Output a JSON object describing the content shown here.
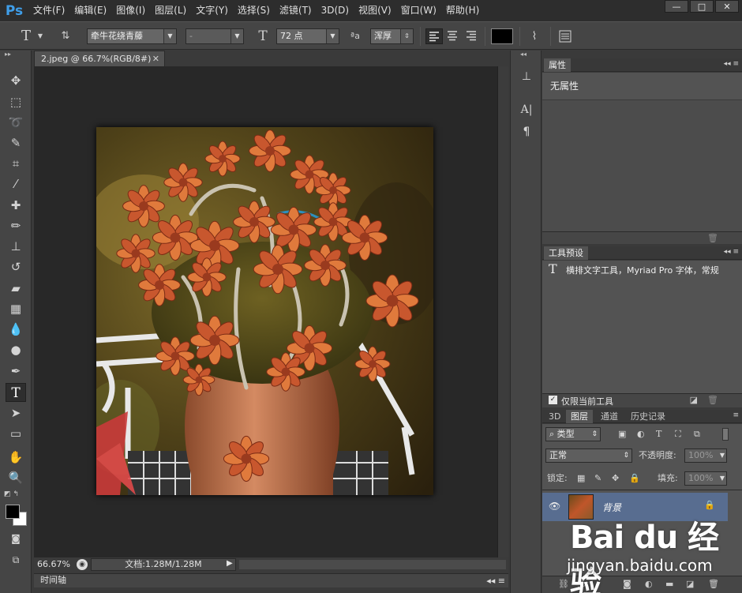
{
  "app": {
    "logo": "Ps"
  },
  "menu": [
    "文件(F)",
    "编辑(E)",
    "图像(I)",
    "图层(L)",
    "文字(Y)",
    "选择(S)",
    "滤镜(T)",
    "3D(D)",
    "视图(V)",
    "窗口(W)",
    "帮助(H)"
  ],
  "window_controls": {
    "minimize": "—",
    "maximize": "□",
    "close": "✕"
  },
  "options": {
    "tool_icon": "T",
    "font_family": "牵牛花绕青藤",
    "font_style": "-",
    "font_size": "72 点",
    "aa_label": "ªa",
    "antialias": "浑厚",
    "color": "#000000"
  },
  "document": {
    "tab_title": "2.jpeg @ 66.7%(RGB/8#)",
    "zoom": "66.67%",
    "doc_size": "文档:1.28M/1.28M"
  },
  "timeline": {
    "label": "时间轴"
  },
  "properties": {
    "tab": "属性",
    "content": "无属性"
  },
  "tool_presets": {
    "tab": "工具预设",
    "item": "横排文字工具，Myriad Pro 字体，常规",
    "checkbox_label": "仅限当前工具",
    "checked": true
  },
  "layers": {
    "tabs": [
      "3D",
      "图层",
      "通道",
      "历史记录"
    ],
    "active_tab": "图层",
    "filter_kind": "类型",
    "blend_mode": "正常",
    "opacity_label": "不透明度:",
    "opacity_value": "100%",
    "lock_label": "锁定:",
    "fill_label": "填充:",
    "fill_value": "100%",
    "items": [
      {
        "name": "背景",
        "locked": true,
        "visible": true
      }
    ]
  },
  "watermark": {
    "logo_text": "Bai du 经验",
    "url": "jingyan.baidu.com"
  }
}
